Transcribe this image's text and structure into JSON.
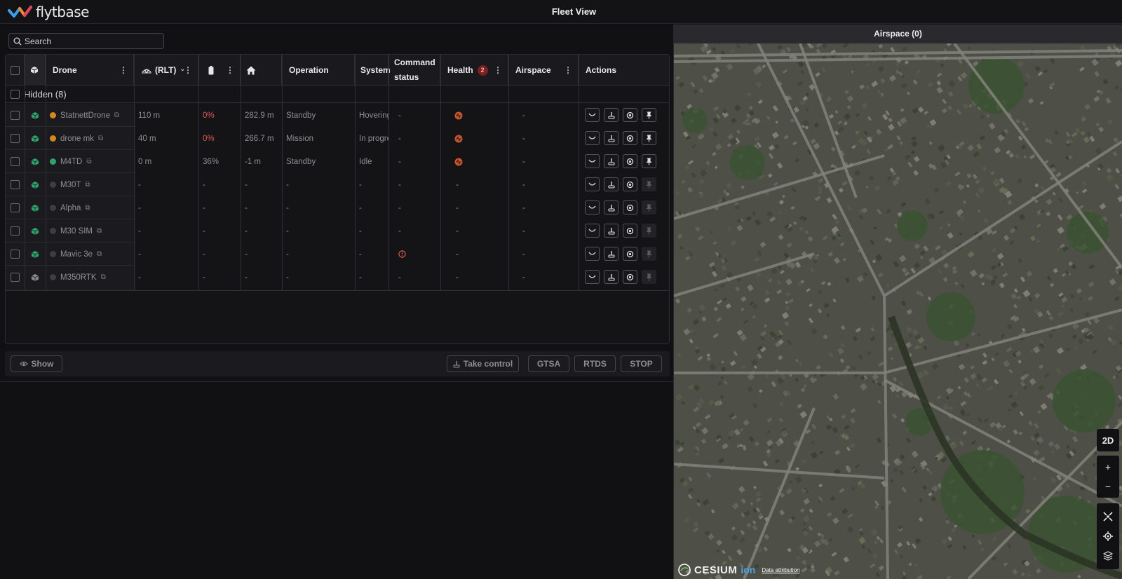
{
  "app": {
    "logo_text": "flytbase",
    "title": "Fleet View"
  },
  "search": {
    "placeholder": "Search"
  },
  "table": {
    "headers": {
      "drone": "Drone",
      "altitude": "(RLT)",
      "operation": "Operation",
      "system": "System",
      "command_status": "Command status",
      "health": "Health",
      "health_badge": "2",
      "airspace": "Airspace",
      "actions": "Actions"
    },
    "hidden_group": "Hidden (8)",
    "rows": [
      {
        "name": "StatnettDrone",
        "status_color": "#d4891f",
        "altitude": "110 m",
        "battery": "0%",
        "home": "282.9 m",
        "operation": "Standby",
        "system": "Hovering",
        "command": "-",
        "health": "warn",
        "airspace": "-",
        "cube_color": "#2fa36b",
        "pin_active": true
      },
      {
        "name": "drone mk",
        "status_color": "#d4891f",
        "altitude": "40 m",
        "battery": "0%",
        "home": "266.7 m",
        "operation": "Mission",
        "system": "In progre",
        "command": "-",
        "health": "warn",
        "airspace": "-",
        "cube_color": "#2fa36b",
        "pin_active": true
      },
      {
        "name": "M4TD",
        "status_color": "#2fa36b",
        "altitude": "0 m",
        "battery": "36%",
        "home": "-1 m",
        "operation": "Standby",
        "system": "Idle",
        "command": "-",
        "health": "warn",
        "airspace": "-",
        "cube_color": "#2fa36b",
        "pin_active": true
      },
      {
        "name": "M30T",
        "status_color": "#3d3d42",
        "altitude": "-",
        "battery": "-",
        "home": "-",
        "operation": "-",
        "system": "-",
        "command": "-",
        "health": "-",
        "airspace": "-",
        "cube_color": "#2fa36b",
        "pin_active": false
      },
      {
        "name": "Alpha",
        "status_color": "#3d3d42",
        "altitude": "-",
        "battery": "-",
        "home": "-",
        "operation": "-",
        "system": "-",
        "command": "-",
        "health": "-",
        "airspace": "-",
        "cube_color": "#2fa36b",
        "pin_active": false
      },
      {
        "name": "M30 SIM",
        "status_color": "#3d3d42",
        "altitude": "-",
        "battery": "-",
        "home": "-",
        "operation": "-",
        "system": "-",
        "command": "-",
        "health": "-",
        "airspace": "-",
        "cube_color": "#2fa36b",
        "pin_active": false
      },
      {
        "name": "Mavic 3e",
        "status_color": "#3d3d42",
        "altitude": "-",
        "battery": "-",
        "home": "-",
        "operation": "-",
        "system": "-",
        "command": "error",
        "health": "-",
        "airspace": "-",
        "cube_color": "#2fa36b",
        "pin_active": false
      },
      {
        "name": "M350RTK",
        "status_color": "#3d3d42",
        "altitude": "-",
        "battery": "-",
        "home": "-",
        "operation": "-",
        "system": "-",
        "command": "-",
        "health": "-",
        "airspace": "-",
        "cube_color": "#8a8a90",
        "pin_active": false
      }
    ]
  },
  "bottom_bar": {
    "show": "Show",
    "take_control": "Take control",
    "gtsa": "GTSA",
    "rtds": "RTDS",
    "stop": "STOP"
  },
  "map": {
    "header": "Airspace (0)",
    "mode": "2D",
    "zoom_in": "+",
    "zoom_out": "−",
    "cesium": "CESIUM",
    "ion": "ion",
    "attribution": "Data attribution"
  },
  "colors": {
    "accent_red": "#e05a4f",
    "warn_orange": "#c9552c"
  }
}
